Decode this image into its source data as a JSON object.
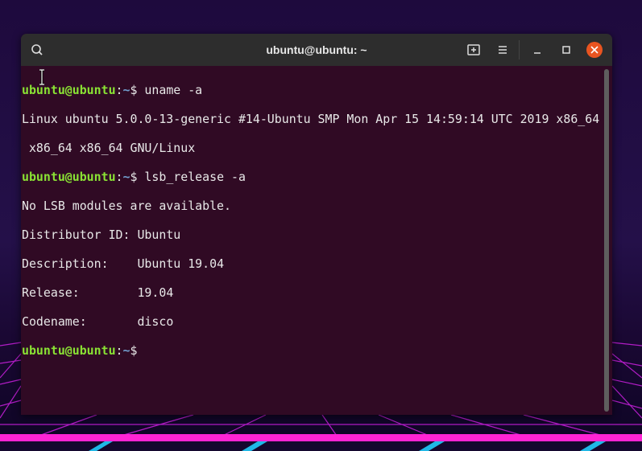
{
  "window": {
    "title": "ubuntu@ubuntu: ~"
  },
  "icons": {
    "search": "search-icon",
    "new_tab": "new-tab-icon",
    "menu": "hamburger-menu-icon",
    "minimize": "minimize-icon",
    "maximize": "maximize-icon",
    "close": "close-icon"
  },
  "colors": {
    "terminal_bg": "#300a24",
    "prompt_user": "#8ae234",
    "prompt_path": "#729fcf",
    "close_button": "#e95420"
  },
  "terminal": {
    "prompt_user": "ubuntu@ubuntu",
    "prompt_sep": ":",
    "prompt_path": "~",
    "prompt_symbol": "$",
    "cmd1": " uname -a",
    "out1": "Linux ubuntu 5.0.0-13-generic #14-Ubuntu SMP Mon Apr 15 14:59:14 UTC 2019 x86_64",
    "out2": " x86_64 x86_64 GNU/Linux",
    "cmd2": " lsb_release -a",
    "out3": "No LSB modules are available.",
    "out4": "Distributor ID:\tUbuntu",
    "out5": "Description:\tUbuntu 19.04",
    "out6": "Release:\t19.04",
    "out7": "Codename:\tdisco"
  }
}
